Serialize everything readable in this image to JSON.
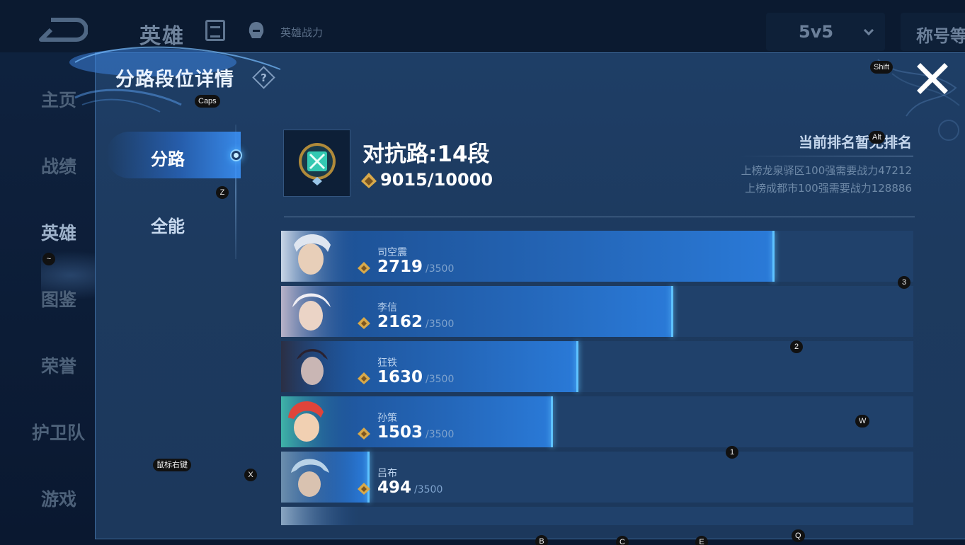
{
  "background": {
    "page_title": "英雄",
    "hero_power_label": "英雄战力",
    "mode_label": "5v5",
    "titles_label": "称号等",
    "nav": [
      {
        "label": "主页"
      },
      {
        "label": "战绩"
      },
      {
        "label": "英雄"
      },
      {
        "label": "图鉴"
      },
      {
        "label": "荣誉"
      },
      {
        "label": "护卫队"
      },
      {
        "label": "游戏"
      }
    ]
  },
  "modal": {
    "title": "分路段位详情",
    "tabs": [
      {
        "label": "分路"
      },
      {
        "label": "全能"
      }
    ],
    "lane_title": "对抗路:14段",
    "score": "9015/10000",
    "ranking_status": "当前排名暂无排名",
    "requirements": [
      "上榜龙泉驿区100强需要战力47212",
      "上榜成都市100强需要战力128886"
    ],
    "heroes": [
      {
        "name": "司空震",
        "score": "2719",
        "max": "/3500",
        "progress": 0.78
      },
      {
        "name": "李信",
        "score": "2162",
        "max": "/3500",
        "progress": 0.62
      },
      {
        "name": "狂铁",
        "score": "1630",
        "max": "/3500",
        "progress": 0.47
      },
      {
        "name": "孙策",
        "score": "1503",
        "max": "/3500",
        "progress": 0.43
      },
      {
        "name": "吕布",
        "score": "494",
        "max": "/3500",
        "progress": 0.14
      },
      {
        "name": "",
        "score": "",
        "max": "",
        "progress": 0.0
      }
    ]
  },
  "key_hints": [
    "Caps",
    "Shift",
    "Alt",
    "Z",
    "~",
    "3",
    "2",
    "W",
    "1",
    "鼠标右键",
    "X",
    "B",
    "C",
    "E",
    "Q"
  ],
  "colors": {
    "modal_bg": "#1e3e66",
    "bar_fill": "#2466b8",
    "bar_edge": "#5ec2ff",
    "row_bg": "#20416b"
  }
}
